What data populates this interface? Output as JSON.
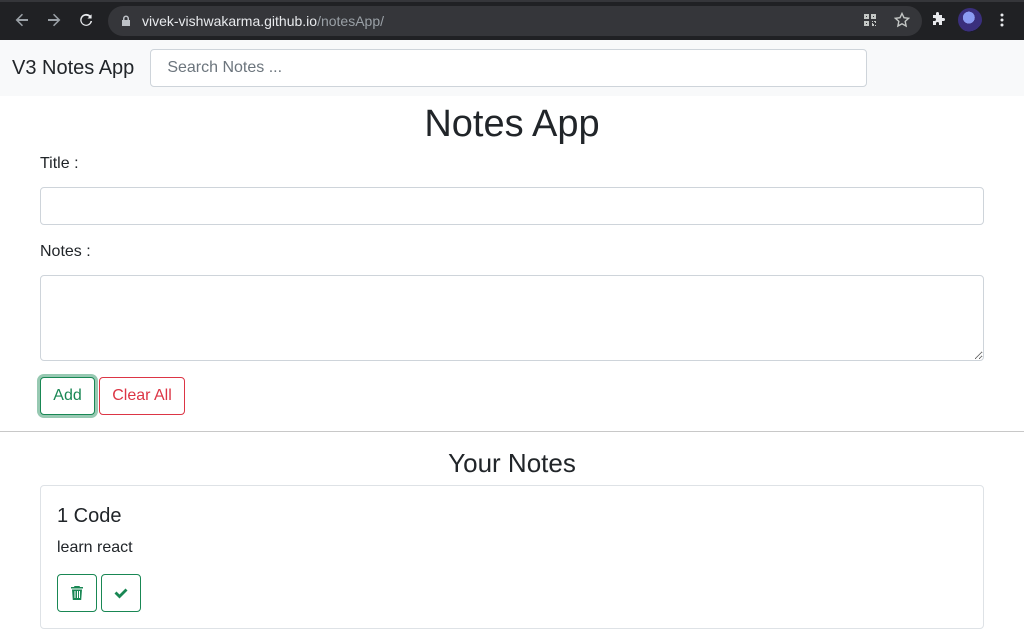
{
  "browser": {
    "url_host": "vivek-vishwakarma.github.io",
    "url_path": "/notesApp/"
  },
  "navbar": {
    "brand": "V3 Notes App",
    "search_placeholder": "Search Notes ..."
  },
  "form": {
    "heading": "Notes App",
    "title_label": "Title :",
    "title_value": "",
    "notes_label": "Notes :",
    "notes_value": "",
    "add_label": "Add",
    "clear_label": "Clear All"
  },
  "notes_section": {
    "heading": "Your Notes",
    "notes": [
      {
        "title": "1 Code",
        "body": "learn react"
      }
    ]
  },
  "colors": {
    "success": "#198754",
    "danger": "#dc3545",
    "navbar_bg": "#f8f9fa"
  },
  "icons": {
    "delete": "trash-icon",
    "done": "check-icon"
  }
}
